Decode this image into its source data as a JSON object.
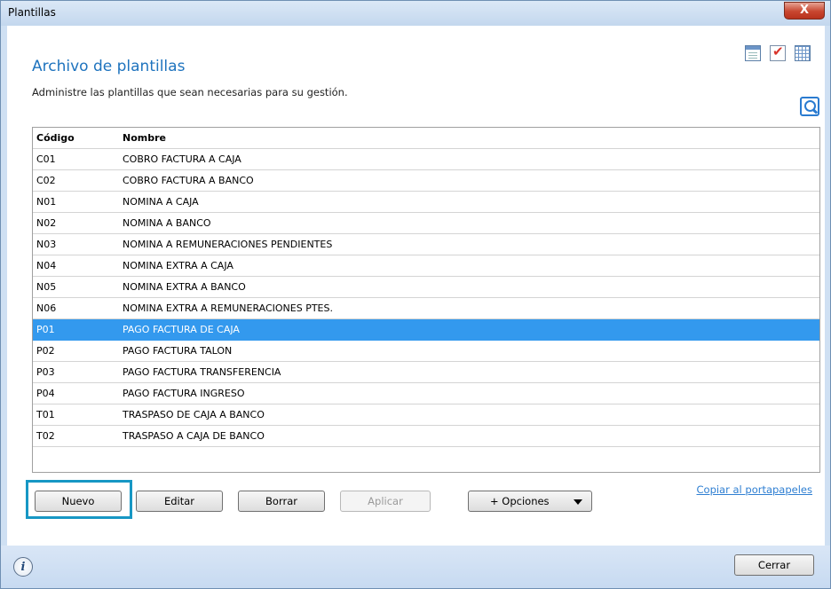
{
  "window": {
    "title": "Plantillas",
    "close_glyph": "X"
  },
  "header": {
    "title": "Archivo de plantillas",
    "subtitle": "Administre las plantillas que sean necesarias para su gestión."
  },
  "toolbar_icons": [
    "calendar-icon",
    "checklist-icon",
    "grid-icon"
  ],
  "search_icon": "search-icon",
  "table": {
    "columns": [
      "Código",
      "Nombre"
    ],
    "rows": [
      {
        "code": "C01",
        "name": "COBRO FACTURA A CAJA"
      },
      {
        "code": "C02",
        "name": "COBRO FACTURA A BANCO"
      },
      {
        "code": "N01",
        "name": "NOMINA A CAJA"
      },
      {
        "code": "N02",
        "name": "NOMINA A BANCO"
      },
      {
        "code": "N03",
        "name": "NOMINA A REMUNERACIONES PENDIENTES"
      },
      {
        "code": "N04",
        "name": "NOMINA EXTRA A CAJA"
      },
      {
        "code": "N05",
        "name": "NOMINA EXTRA A BANCO"
      },
      {
        "code": "N06",
        "name": "NOMINA EXTRA A REMUNERACIONES PTES."
      },
      {
        "code": "P01",
        "name": "PAGO FACTURA DE CAJA"
      },
      {
        "code": "P02",
        "name": "PAGO FACTURA TALON"
      },
      {
        "code": "P03",
        "name": "PAGO FACTURA TRANSFERENCIA"
      },
      {
        "code": "P04",
        "name": "PAGO FACTURA INGRESO"
      },
      {
        "code": "T01",
        "name": "TRASPASO DE CAJA A BANCO"
      },
      {
        "code": "T02",
        "name": "TRASPASO A CAJA DE BANCO"
      }
    ],
    "selected_index": 8
  },
  "buttons": {
    "new": "Nuevo",
    "edit": "Editar",
    "delete": "Borrar",
    "apply": "Aplicar",
    "options": "+ Opciones",
    "copy": "Copiar al portapapeles",
    "close": "Cerrar"
  },
  "colors": {
    "accent": "#1e73be",
    "selection": "#3399ee",
    "highlight_border": "#1797c4"
  }
}
